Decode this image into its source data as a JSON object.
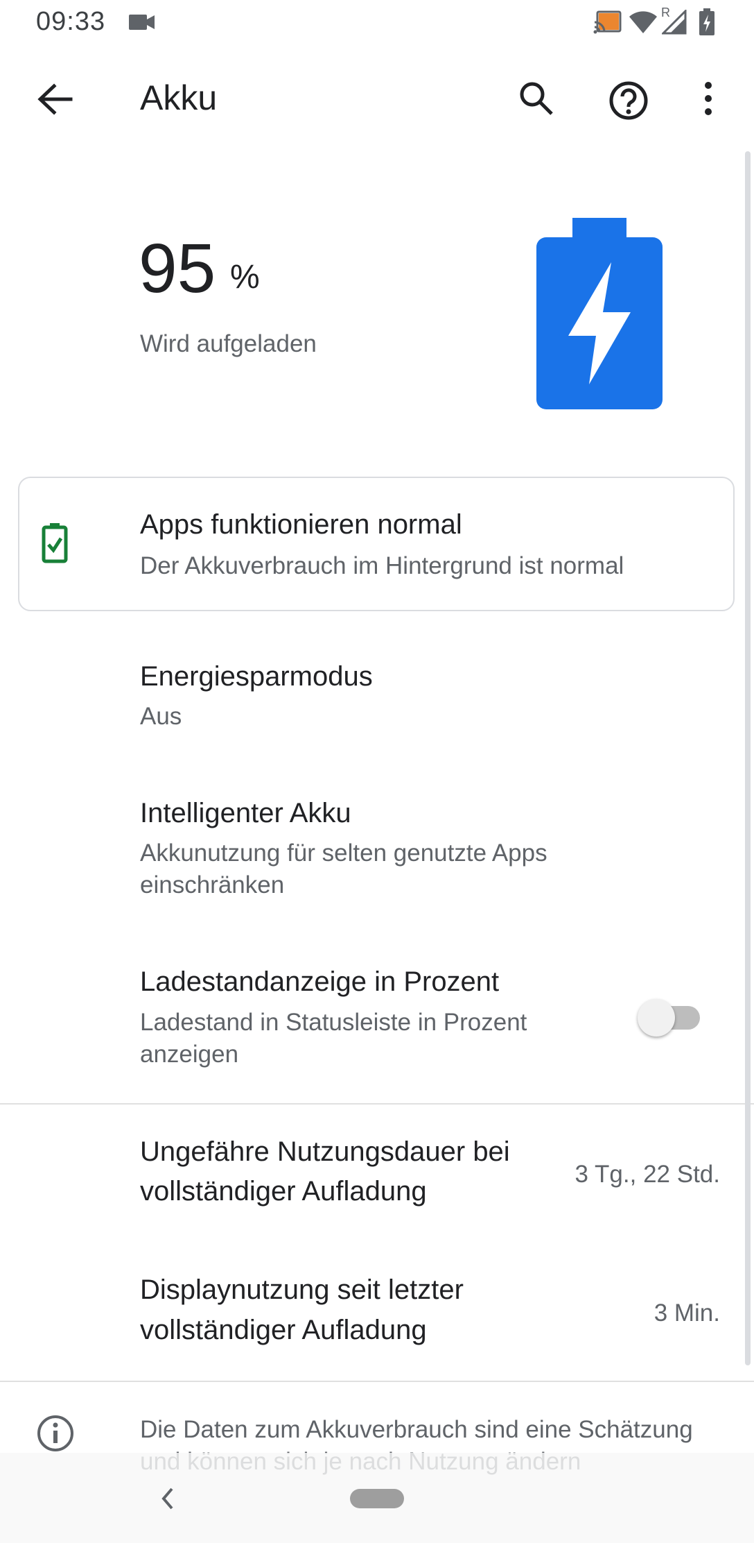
{
  "status_bar": {
    "time": "09:33",
    "icons": [
      "video-camera-icon",
      "cast-icon",
      "wifi-icon",
      "signal-roaming-icon",
      "battery-charging-icon"
    ],
    "roaming_label": "R"
  },
  "app_bar": {
    "title": "Akku",
    "back_icon": "arrow-back-icon",
    "search_icon": "search-icon",
    "help_icon": "help-circle-icon",
    "overflow_icon": "more-vert-icon"
  },
  "battery": {
    "level_number": "95",
    "level_unit": "%",
    "level_fraction": 0.95,
    "status": "Wird aufgeladen",
    "icon": "battery-charging-large-icon",
    "accent_color": "#1a73e8"
  },
  "tip_card": {
    "title": "Apps funktionieren normal",
    "subtitle": "Der Akkuverbrauch im Hintergrund ist normal",
    "icon": "battery-check-icon",
    "icon_color": "#188038"
  },
  "settings": [
    {
      "title": "Energiesparmodus",
      "subtitle": "Aus"
    },
    {
      "title": "Intelligenter Akku",
      "subtitle": "Akkunutzung für selten genutzte Apps einschränken"
    },
    {
      "title": "Ladestandanzeige in Prozent",
      "subtitle": "Ladestand in Statusleiste in Prozent anzeigen",
      "toggle_on": false
    }
  ],
  "usage": [
    {
      "title_line1": "Ungefähre Nutzungsdauer bei",
      "title_line2": "vollständiger Aufladung",
      "value": "3 Tg., 22 Std."
    },
    {
      "title_line1": "Displaynutzung seit letzter",
      "title_line2": "vollständiger Aufladung",
      "value": "3 Min."
    }
  ],
  "footer": {
    "icon": "info-icon",
    "text": "Die Daten zum Akkuverbrauch sind eine Schätzung und können sich je nach Nutzung ändern"
  },
  "nav_bar": {
    "back_icon": "nav-back-chevron-icon",
    "home_icon": "home-pill-icon"
  }
}
